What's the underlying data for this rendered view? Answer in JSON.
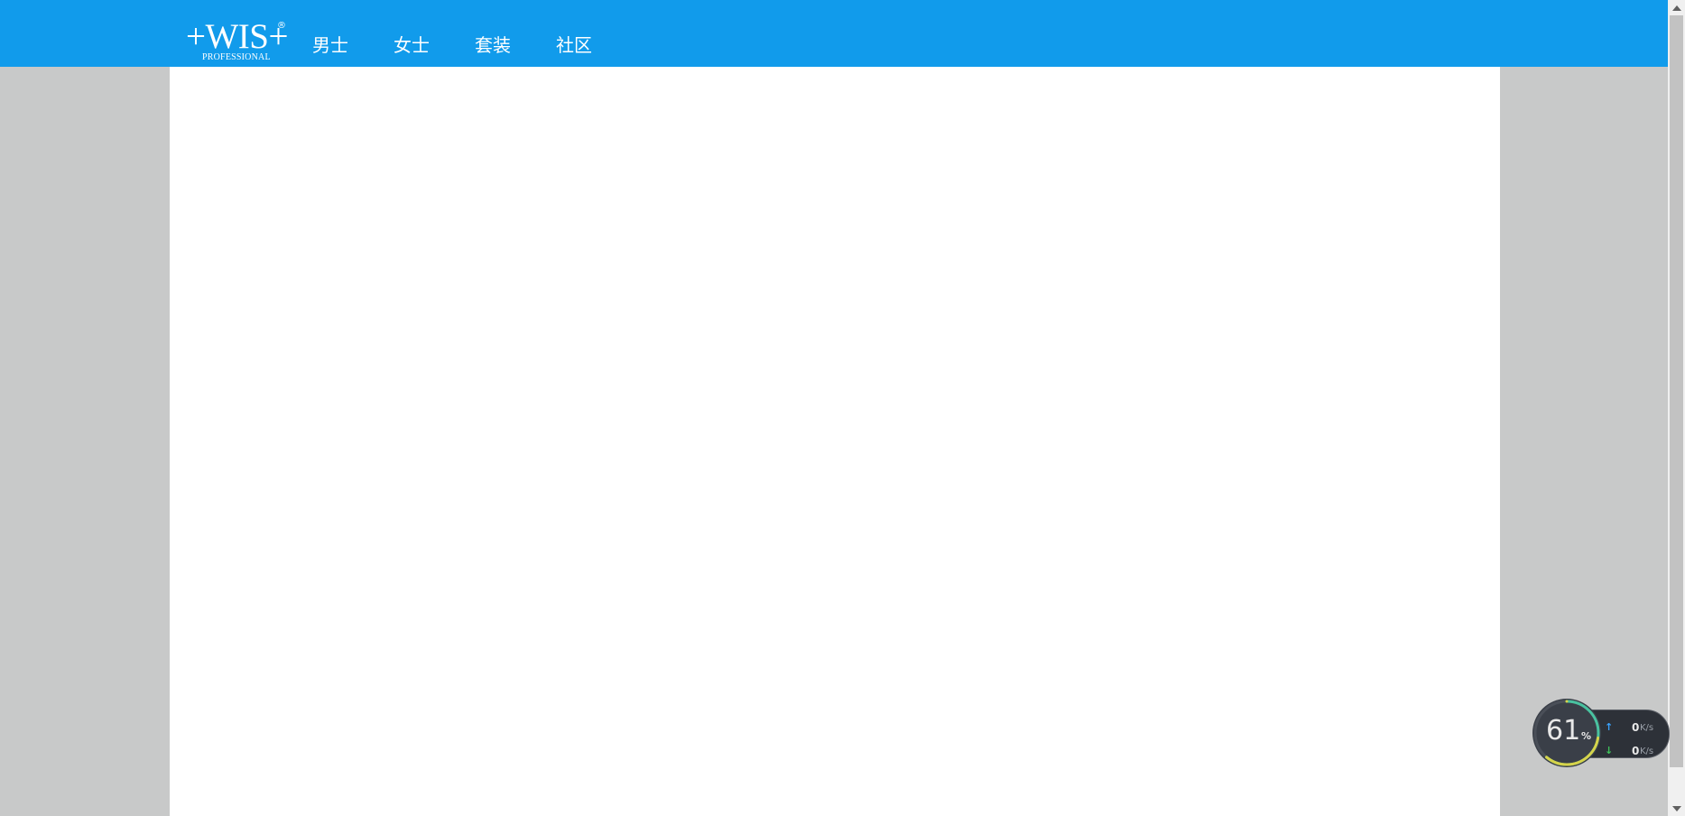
{
  "header": {
    "logo": {
      "main": "+WIS+",
      "registered": "®",
      "sub": "PROFESSIONAL"
    },
    "nav": [
      {
        "label": "男士"
      },
      {
        "label": "女士"
      },
      {
        "label": "套装"
      },
      {
        "label": "社区"
      }
    ],
    "bg_color": "#119beb"
  },
  "speed_widget": {
    "percent": "61",
    "percent_sign": "%",
    "upload": {
      "value": "0",
      "unit": "K/s",
      "icon": "arrow-up-icon"
    },
    "download": {
      "value": "0",
      "unit": "K/s",
      "icon": "arrow-down-icon"
    },
    "fraction": 0.61
  },
  "colors": {
    "page_bg": "#c8c9c9",
    "content_bg": "#ffffff",
    "upload_arrow": "#3aa3ff",
    "download_arrow": "#3ec35a"
  }
}
